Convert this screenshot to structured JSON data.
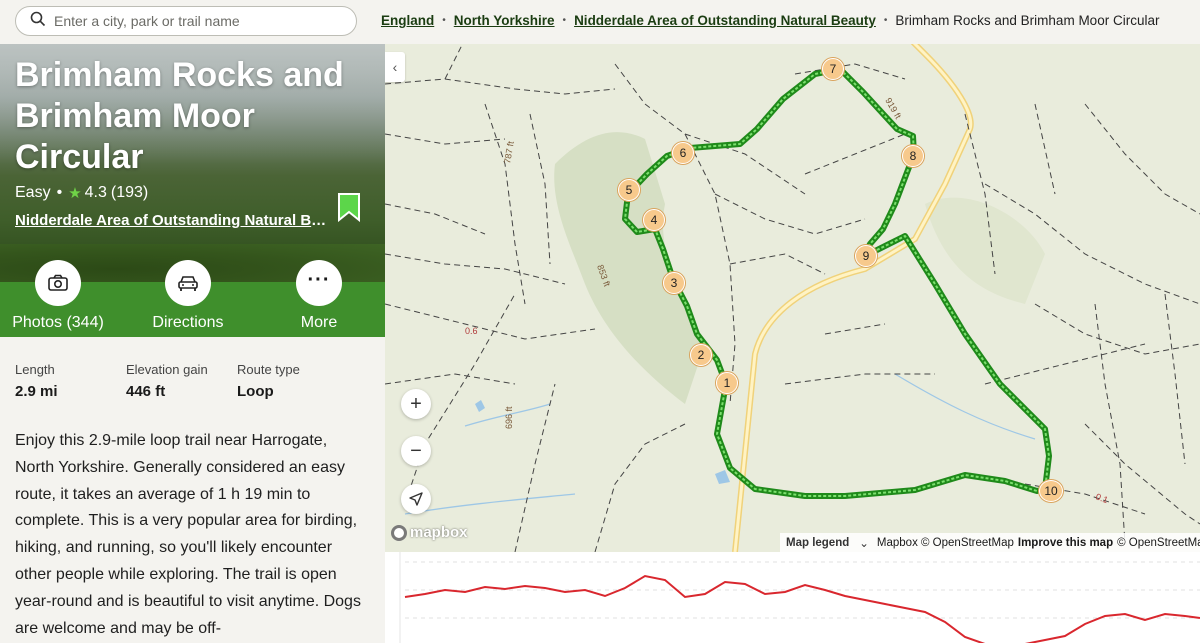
{
  "search": {
    "placeholder": "Enter a city, park or trail name"
  },
  "breadcrumbs": [
    {
      "label": "England"
    },
    {
      "label": "North Yorkshire"
    },
    {
      "label": "Nidderdale Area of Outstanding Natural Beauty"
    },
    {
      "label": "Brimham Rocks and Brimham Moor Circular"
    }
  ],
  "trail": {
    "title": "Brimham Rocks and Brimham Moor Circular",
    "difficulty": "Easy",
    "rating": "4.3",
    "reviews": "(193)",
    "area": "Nidderdale Area of Outstanding Natural Beauty"
  },
  "actions": {
    "photos": "Photos (344)",
    "directions": "Directions",
    "more": "More"
  },
  "stats": {
    "length_label": "Length",
    "length_value": "2.9 mi",
    "elevation_label": "Elevation gain",
    "elevation_value": "446 ft",
    "route_label": "Route type",
    "route_value": "Loop"
  },
  "description": "Enjoy this 2.9-mile loop trail near Harrogate, North Yorkshire. Generally considered an easy route, it takes an average of 1 h 19 min to complete. This is a very popular area for birding, hiking, and running, so you'll likely encounter other people while exploring. The trail is open year-round and is beautiful to visit anytime. Dogs are welcome and may be off-",
  "map": {
    "elevation_labels": [
      "919 ft",
      "787 ft",
      "853 ft",
      "696 ft"
    ],
    "grid_labels": [
      "0.6",
      "0.1"
    ],
    "markers": [
      "1",
      "2",
      "3",
      "4",
      "5",
      "6",
      "7",
      "8",
      "9",
      "10"
    ],
    "logo": "mapbox",
    "attribution": {
      "legend": "Map legend",
      "mapbox": "Mapbox © OpenStreetMap",
      "improve": "Improve this map",
      "osm": "© OpenStreetMap"
    },
    "colors": {
      "route": "#3fbf3a",
      "road": "#f0d27a",
      "land": "#e9ecdc",
      "elevation_line": "#d9272e"
    }
  }
}
